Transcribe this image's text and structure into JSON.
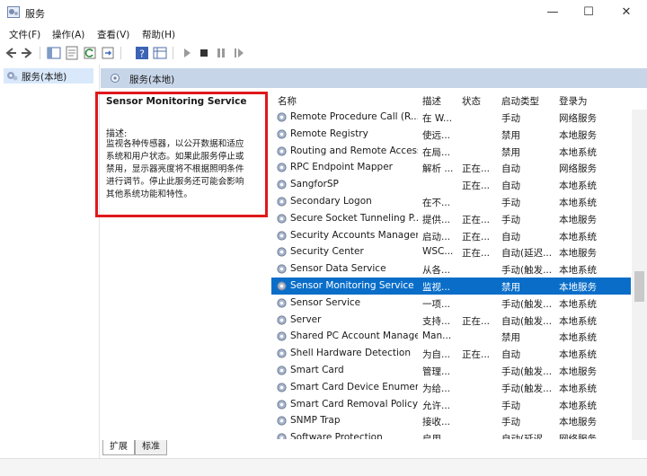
{
  "window": {
    "title": "服务",
    "min": "—",
    "max": "☐",
    "close": "✕"
  },
  "menu": [
    "文件(F)",
    "操作(A)",
    "查看(V)",
    "帮助(H)"
  ],
  "tree": {
    "item": "服务(本地)"
  },
  "pane": {
    "header": "服务(本地)"
  },
  "description": {
    "title": "Sensor Monitoring Service",
    "label": "描述:",
    "lines": [
      "监视各种传感器，以公开数据和适应",
      "系统和用户状态。如果此服务停止或",
      "禁用，显示器亮度将不根据照明条件",
      "进行调节。停止此服务还可能会影响",
      "其他系统功能和特性。"
    ]
  },
  "columns": {
    "name": "名称",
    "desc": "描述",
    "status": "状态",
    "type": "启动类型",
    "logon": "登录为"
  },
  "services": [
    {
      "name": "Remote Procedure Call (R...",
      "desc": "在 W...",
      "status": "",
      "type": "手动",
      "logon": "网络服务"
    },
    {
      "name": "Remote Registry",
      "desc": "使远...",
      "status": "",
      "type": "禁用",
      "logon": "本地服务"
    },
    {
      "name": "Routing and Remote Access",
      "desc": "在局...",
      "status": "",
      "type": "禁用",
      "logon": "本地系统"
    },
    {
      "name": "RPC Endpoint Mapper",
      "desc": "解析 ...",
      "status": "正在...",
      "type": "自动",
      "logon": "网络服务"
    },
    {
      "name": "SangforSP",
      "desc": "",
      "status": "正在...",
      "type": "自动",
      "logon": "本地系统"
    },
    {
      "name": "Secondary Logon",
      "desc": "在不...",
      "status": "",
      "type": "手动",
      "logon": "本地系统"
    },
    {
      "name": "Secure Socket Tunneling P...",
      "desc": "提供...",
      "status": "正在...",
      "type": "手动",
      "logon": "本地服务"
    },
    {
      "name": "Security Accounts Manager",
      "desc": "启动...",
      "status": "正在...",
      "type": "自动",
      "logon": "本地系统"
    },
    {
      "name": "Security Center",
      "desc": "WSC...",
      "status": "正在...",
      "type": "自动(延迟...",
      "logon": "本地服务"
    },
    {
      "name": "Sensor Data Service",
      "desc": "从各...",
      "status": "",
      "type": "手动(触发...",
      "logon": "本地系统"
    },
    {
      "name": "Sensor Monitoring Service",
      "desc": "监视...",
      "status": "",
      "type": "禁用",
      "logon": "本地服务"
    },
    {
      "name": "Sensor Service",
      "desc": "一项...",
      "status": "",
      "type": "手动(触发...",
      "logon": "本地系统"
    },
    {
      "name": "Server",
      "desc": "支持...",
      "status": "正在...",
      "type": "自动(触发...",
      "logon": "本地系统"
    },
    {
      "name": "Shared PC Account Manager",
      "desc": "Man...",
      "status": "",
      "type": "禁用",
      "logon": "本地系统"
    },
    {
      "name": "Shell Hardware Detection",
      "desc": "为自...",
      "status": "正在...",
      "type": "自动",
      "logon": "本地系统"
    },
    {
      "name": "Smart Card",
      "desc": "管理...",
      "status": "",
      "type": "手动(触发...",
      "logon": "本地服务"
    },
    {
      "name": "Smart Card Device Enumer...",
      "desc": "为给...",
      "status": "",
      "type": "手动(触发...",
      "logon": "本地系统"
    },
    {
      "name": "Smart Card Removal Policy",
      "desc": "允许...",
      "status": "",
      "type": "手动",
      "logon": "本地系统"
    },
    {
      "name": "SNMP Trap",
      "desc": "接收...",
      "status": "",
      "type": "手动",
      "logon": "本地服务"
    },
    {
      "name": "Software Protection",
      "desc": "启用...",
      "status": "",
      "type": "自动(延迟...",
      "logon": "网络服务"
    }
  ],
  "selected_service": "Sensor Monitoring Service",
  "tabs": [
    "扩展",
    "标准"
  ],
  "colors": {
    "selection": "#0a6ec9",
    "header_band": "#c7d5e9",
    "highlight_box": "#e0181c"
  }
}
